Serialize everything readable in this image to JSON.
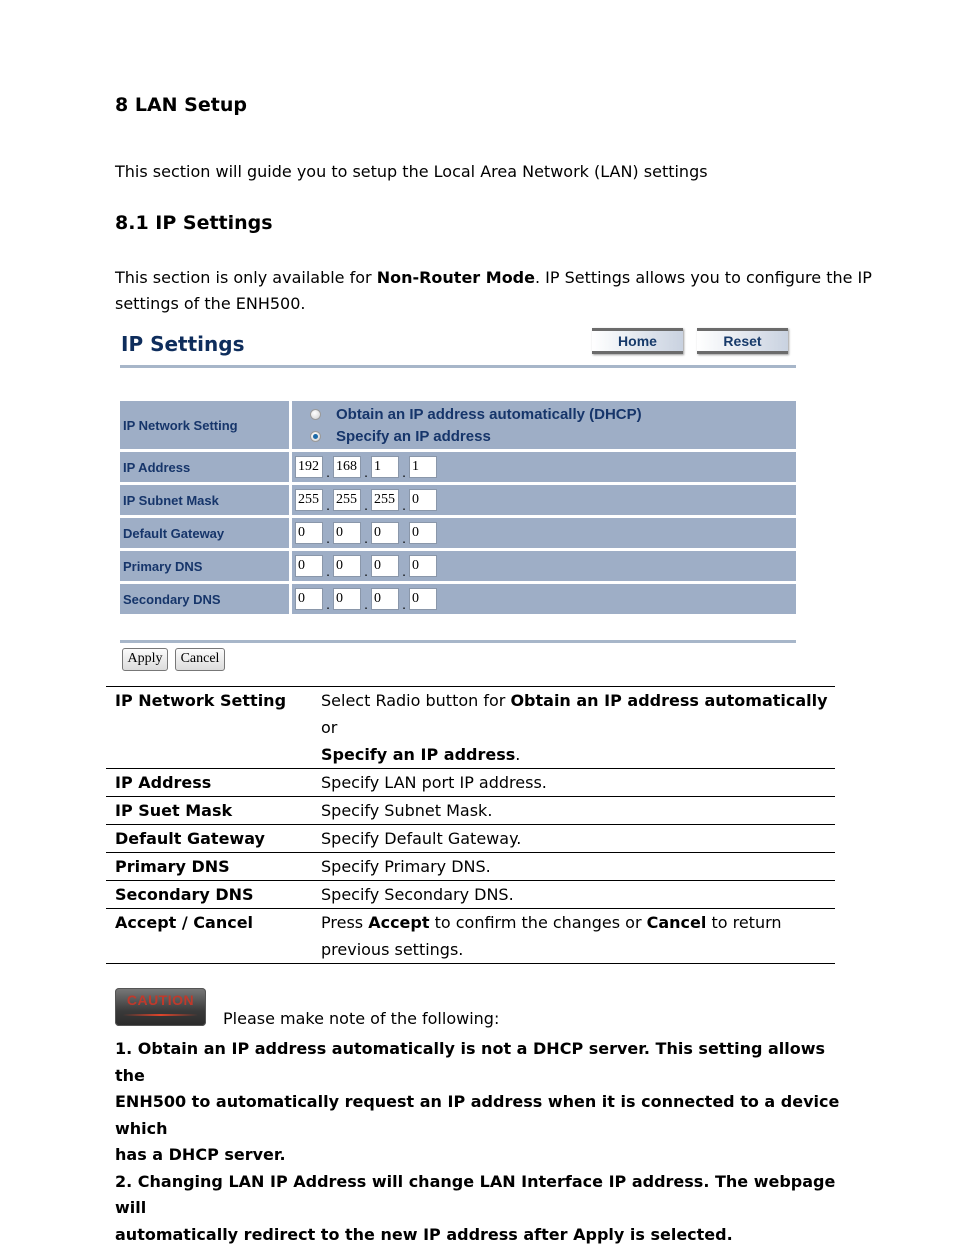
{
  "section": {
    "title": "8 LAN Setup",
    "intro": "This section will guide you to setup the Local Area Network (LAN) settings"
  },
  "subsection": {
    "title": "8.1 IP Settings",
    "desc_pre": "This section is only available for ",
    "desc_bold": "Non-Router Mode",
    "desc_post": ". IP Settings allows you to configure the IP",
    "desc_line2": "settings of the ENH500."
  },
  "ui": {
    "title": "IP Settings",
    "home_label": "Home",
    "reset_label": "Reset",
    "network_setting_label": "IP Network Setting",
    "radio_options": [
      {
        "label": "Obtain an IP address automatically (DHCP)",
        "selected": false
      },
      {
        "label": "Specify an IP address",
        "selected": true
      }
    ],
    "fields": [
      {
        "label": "IP Address",
        "octets": [
          "192",
          "168",
          "1",
          "1"
        ]
      },
      {
        "label": "IP Subnet Mask",
        "octets": [
          "255",
          "255",
          "255",
          "0"
        ]
      },
      {
        "label": "Default Gateway",
        "octets": [
          "0",
          "0",
          "0",
          "0"
        ]
      },
      {
        "label": "Primary DNS",
        "octets": [
          "0",
          "0",
          "0",
          "0"
        ]
      },
      {
        "label": "Secondary DNS",
        "octets": [
          "0",
          "0",
          "0",
          "0"
        ]
      }
    ],
    "apply_label": "Apply",
    "cancel_label": "Cancel",
    "colors": {
      "cell_bg": "#9eaec6",
      "label_text": "#16356a",
      "rule": "#a7b6c9"
    }
  },
  "table": {
    "rows": [
      {
        "key": "IP Network Setting",
        "l1_a": "Select Radio button for ",
        "l1_b": "Obtain an IP address automatically",
        "l1_c": " or",
        "l2_b": "Specify an IP address",
        "l2_c": "."
      },
      {
        "key": "IP Address",
        "value": "Specify LAN port IP address."
      },
      {
        "key": "IP Suet Mask",
        "value": "Specify Subnet Mask."
      },
      {
        "key": "Default Gateway",
        "value": "Specify Default Gateway."
      },
      {
        "key": "Primary DNS",
        "value": "Specify Primary DNS."
      },
      {
        "key": "Secondary DNS",
        "value": "Specify Secondary DNS."
      },
      {
        "key": "Accept / Cancel",
        "l1_a": "Press ",
        "l1_b": "Accept",
        "l1_c": " to confirm the changes or ",
        "l1_d": "Cancel",
        "l1_e": " to return",
        "l2": "previous settings."
      }
    ]
  },
  "caution": {
    "badge": "CAUTION",
    "lead": "Please make note of the following:",
    "note1_l1": "1. Obtain an IP address automatically is not a DHCP server. This setting allows the",
    "note1_l2": "ENH500 to automatically request an IP address when it is connected to a device which",
    "note1_l3": "has a DHCP server.",
    "note2_l1": "2. Changing LAN IP Address will change LAN Interface IP address. The webpage will",
    "note2_l2": "automatically redirect to the new IP address after Apply is selected."
  }
}
